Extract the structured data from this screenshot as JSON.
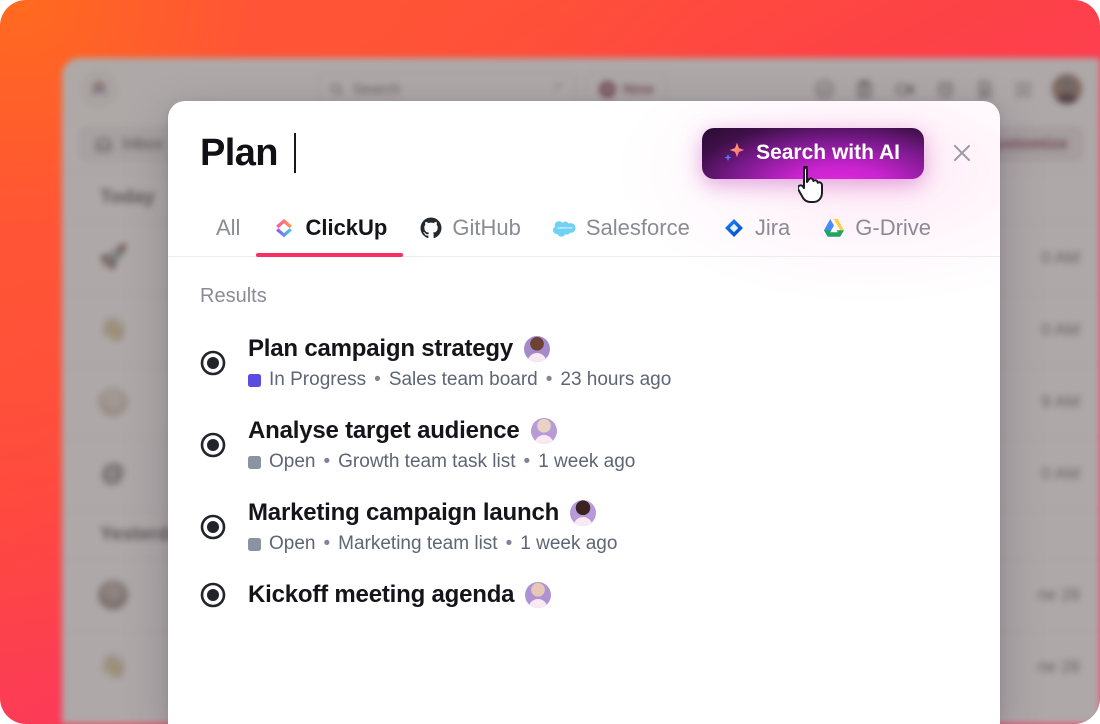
{
  "background_app": {
    "logo_icon": "clickup-logo-icon",
    "search": {
      "placeholder": "Search",
      "icon": "search-icon",
      "ai_icon": "sparkle-icon"
    },
    "new_button": {
      "label": "New",
      "icon": "plus-circle-icon"
    },
    "toolbar_icons": [
      "check-circle-icon",
      "clipboard-icon",
      "video-camera-icon",
      "alarm-clock-icon",
      "document-icon",
      "apps-grid-icon"
    ],
    "avatar": "user-avatar",
    "inbox_tab": {
      "label": "Inbox",
      "icon": "inbox-icon"
    },
    "customize_button": {
      "label": "Customize"
    },
    "sections": [
      {
        "header": "Today",
        "items": [
          {
            "icon": "🚀",
            "type": "emoji",
            "text": "",
            "time": "0 AM"
          },
          {
            "icon": "👋",
            "type": "emoji",
            "text": "",
            "time": "0 AM"
          },
          {
            "icon": "",
            "type": "avatar",
            "avatar_class": "a1",
            "text": "",
            "time": "9 AM"
          },
          {
            "icon": "@",
            "type": "at",
            "text": "",
            "time": "0 AM"
          }
        ]
      },
      {
        "header": "Yesterday",
        "items": [
          {
            "icon": "",
            "type": "avatar",
            "avatar_class": "a2",
            "text": "",
            "time": "ne 28"
          },
          {
            "icon": "👋",
            "type": "emoji",
            "text": "",
            "time": "ne 28"
          }
        ]
      }
    ]
  },
  "modal": {
    "query": "Plan",
    "ai_button": {
      "label": "Search with AI",
      "icon": "sparkle-icon"
    },
    "close_icon": "close-icon",
    "cursor": "hand-pointer-cursor",
    "tabs": [
      {
        "label": "All",
        "icon": "",
        "active": false
      },
      {
        "label": "ClickUp",
        "icon": "clickup-icon",
        "active": true
      },
      {
        "label": "GitHub",
        "icon": "github-icon",
        "active": false
      },
      {
        "label": "Salesforce",
        "icon": "salesforce-icon",
        "active": false
      },
      {
        "label": "Jira",
        "icon": "jira-icon",
        "active": false
      },
      {
        "label": "G-Drive",
        "icon": "google-drive-icon",
        "active": false
      }
    ],
    "results_label": "Results",
    "results": [
      {
        "title": "Plan campaign strategy",
        "avatar_class": "av-p1",
        "status": "In Progress",
        "status_color": "#5A4BE3",
        "location": "Sales team board",
        "time": "23 hours ago"
      },
      {
        "title": "Analyse target audience",
        "avatar_class": "av-p2",
        "status": "Open",
        "status_color": "#8B93A2",
        "location": "Growth team task list",
        "time": "1 week ago"
      },
      {
        "title": "Marketing campaign launch",
        "avatar_class": "av-p3",
        "status": "Open",
        "status_color": "#8B93A2",
        "location": "Marketing team list",
        "time": "1 week ago"
      },
      {
        "title": "Kickoff meeting agenda",
        "avatar_class": "av-p4",
        "status": "",
        "status_color": "#8B93A2",
        "location": "",
        "time": ""
      }
    ],
    "separator": "•"
  },
  "colors": {
    "accent_pink": "#FB2E63",
    "backdrop_orange": "#FF5436",
    "backdrop_pink": "#FC3F63",
    "ai_purple": "#C923CF"
  }
}
